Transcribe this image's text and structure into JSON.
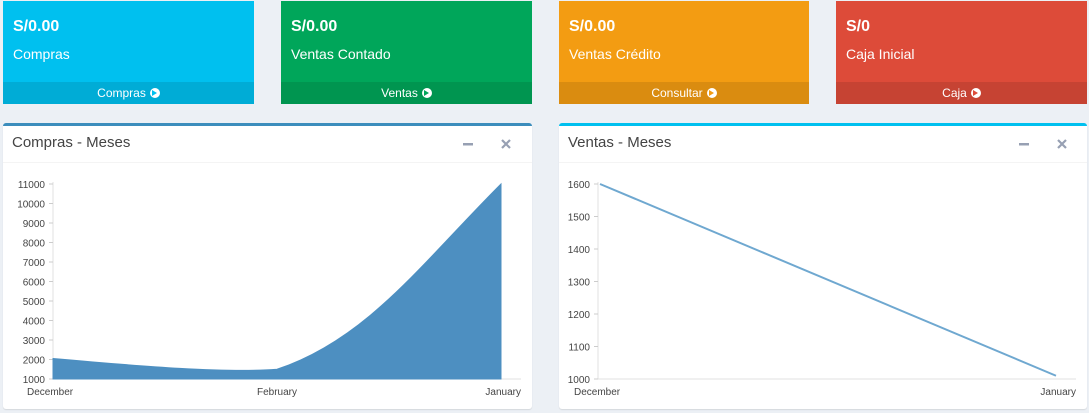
{
  "tiles": [
    {
      "amount": "S/0.00",
      "label": "Compras",
      "link": "Compras",
      "color": "#00c0ef"
    },
    {
      "amount": "S/0.00",
      "label": "Ventas Contado",
      "link": "Ventas",
      "color": "#00a65a"
    },
    {
      "amount": "S/0.00",
      "label": "Ventas Crédito",
      "link": "Consultar",
      "color": "#f39c12"
    },
    {
      "amount": "S/0",
      "label": "Caja Inicial",
      "link": "Caja",
      "color": "#dd4b39"
    }
  ],
  "panels": {
    "compras": {
      "title": "Compras - Meses",
      "accent": "#3c8dbc"
    },
    "ventas": {
      "title": "Ventas - Meses",
      "accent": "#00c0ef"
    }
  },
  "chart_data": [
    {
      "type": "area",
      "categories": [
        "December",
        "February",
        "January"
      ],
      "series": [
        {
          "values": [
            2050,
            1500,
            11000
          ]
        }
      ],
      "ylim": [
        1000,
        11000
      ],
      "yticks": [
        1000,
        2000,
        3000,
        4000,
        5000,
        6000,
        7000,
        8000,
        9000,
        10000,
        11000
      ],
      "color": "#4d8fc1",
      "grid": false
    },
    {
      "type": "line",
      "categories": [
        "December",
        "January"
      ],
      "series": [
        {
          "values": [
            1600,
            1010
          ]
        }
      ],
      "ylim": [
        1000,
        1600
      ],
      "yticks": [
        1000,
        1100,
        1200,
        1300,
        1400,
        1500,
        1600
      ],
      "color": "#6fa8d0",
      "grid": false
    }
  ]
}
